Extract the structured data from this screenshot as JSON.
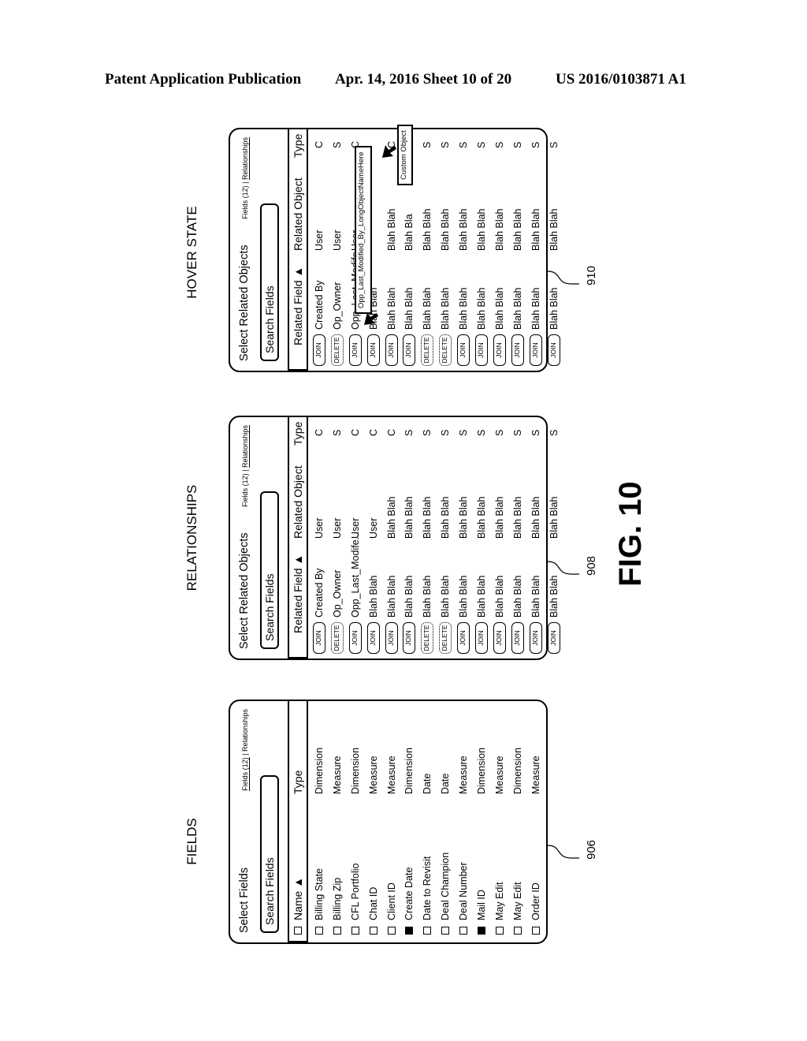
{
  "header": {
    "publication": "Patent Application Publication",
    "date_sheet": "Apr. 14, 2016  Sheet 10 of 20",
    "number": "US 2016/0103871 A1"
  },
  "figure_label": "FIG. 10",
  "panels": {
    "fields": {
      "caption": "FIELDS",
      "ref": "906",
      "title": "Select Fields",
      "tab_fields": "Fields (12)",
      "tab_sep": " | ",
      "tab_relationships": "Relationships",
      "active_tab": "fields",
      "search_placeholder": "Search Fields",
      "col_name": "Name ▲",
      "col_type": "Type",
      "rows": [
        {
          "name": "Billing State",
          "type": "Dimension",
          "checked": false
        },
        {
          "name": "Billing Zip",
          "type": "Measure",
          "checked": false
        },
        {
          "name": "CFL Portfolio",
          "type": "Dimension",
          "checked": false
        },
        {
          "name": "Chat ID",
          "type": "Measure",
          "checked": false
        },
        {
          "name": "Client ID",
          "type": "Measure",
          "checked": false
        },
        {
          "name": "Create Date",
          "type": "Dimension",
          "checked": true
        },
        {
          "name": "Date to Revisit",
          "type": "Date",
          "checked": false
        },
        {
          "name": "Deal Champion",
          "type": "Date",
          "checked": false
        },
        {
          "name": "Deal Number",
          "type": "Measure",
          "checked": false
        },
        {
          "name": "Mail ID",
          "type": "Dimension",
          "checked": true
        },
        {
          "name": "May Edit",
          "type": "Measure",
          "checked": false
        },
        {
          "name": "May Edit",
          "type": "Dimension",
          "checked": false
        },
        {
          "name": "Order ID",
          "type": "Measure",
          "checked": false
        }
      ]
    },
    "relationships": {
      "caption": "RELATIONSHIPS",
      "ref": "908",
      "title": "Select Related Objects",
      "tab_fields": "Fields (12)",
      "tab_sep": " | ",
      "tab_relationships": "Relationships",
      "active_tab": "relationships",
      "search_placeholder": "Search Fields",
      "col_field": "Related Field ▲",
      "col_object": "Related Object",
      "col_type": "Type",
      "rows": [
        {
          "action": "JOIN",
          "field": "Created By",
          "object": "User",
          "type": "C"
        },
        {
          "action": "DELETE",
          "field": "Op_Owner",
          "object": "User",
          "type": "S"
        },
        {
          "action": "JOIN",
          "field": "Opp_Last_Modife...",
          "object": "User",
          "type": "C"
        },
        {
          "action": "JOIN",
          "field": "Blah Blah",
          "object": "User",
          "type": "C"
        },
        {
          "action": "JOIN",
          "field": "Blah Blah",
          "object": "Blah Blah",
          "type": "C"
        },
        {
          "action": "JOIN",
          "field": "Blah Blah",
          "object": "Blah Blah",
          "type": "S"
        },
        {
          "action": "DELETE",
          "field": "Blah Blah",
          "object": "Blah Blah",
          "type": "S"
        },
        {
          "action": "DELETE",
          "field": "Blah Blah",
          "object": "Blah Blah",
          "type": "S"
        },
        {
          "action": "JOIN",
          "field": "Blah Blah",
          "object": "Blah Blah",
          "type": "S"
        },
        {
          "action": "JOIN",
          "field": "Blah Blah",
          "object": "Blah Blah",
          "type": "S"
        },
        {
          "action": "JOIN",
          "field": "Blah Blah",
          "object": "Blah Blah",
          "type": "S"
        },
        {
          "action": "JOIN",
          "field": "Blah Blah",
          "object": "Blah Blah",
          "type": "S"
        },
        {
          "action": "JOIN",
          "field": "Blah Blah",
          "object": "Blah Blah",
          "type": "S"
        },
        {
          "action": "JOIN",
          "field": "Blah Blah",
          "object": "Blah Blah",
          "type": "S"
        }
      ]
    },
    "hover": {
      "caption": "HOVER STATE",
      "ref": "910",
      "title": "Select Related Objects",
      "tab_fields": "Fields (12)",
      "tab_sep": " | ",
      "tab_relationships": "Relationships",
      "active_tab": "relationships",
      "search_placeholder": "Search Fields",
      "col_field": "Related Field ▲",
      "col_object": "Related Object",
      "col_type": "Type",
      "rows": [
        {
          "action": "JOIN",
          "field": "Created By",
          "object": "User",
          "type": "C"
        },
        {
          "action": "DELETE",
          "field": "Op_Owner",
          "object": "User",
          "type": "S"
        },
        {
          "action": "JOIN",
          "field": "Opp_Last_Modife...",
          "object": "User",
          "type": "C"
        },
        {
          "action": "JOIN",
          "field": "Blah Blah",
          "object": "",
          "type": ""
        },
        {
          "action": "JOIN",
          "field": "Blah Blah",
          "object": "Blah Blah",
          "type": "C"
        },
        {
          "action": "JOIN",
          "field": "Blah Blah",
          "object": "Blah Bla",
          "type": ""
        },
        {
          "action": "DELETE",
          "field": "Blah Blah",
          "object": "Blah Blah",
          "type": "S"
        },
        {
          "action": "DELETE",
          "field": "Blah Blah",
          "object": "Blah Blah",
          "type": "S"
        },
        {
          "action": "JOIN",
          "field": "Blah Blah",
          "object": "Blah Blah",
          "type": "S"
        },
        {
          "action": "JOIN",
          "field": "Blah Blah",
          "object": "Blah Blah",
          "type": "S"
        },
        {
          "action": "JOIN",
          "field": "Blah Blah",
          "object": "Blah Blah",
          "type": "S"
        },
        {
          "action": "JOIN",
          "field": "Blah Blah",
          "object": "Blah Blah",
          "type": "S"
        },
        {
          "action": "JOIN",
          "field": "Blah Blah",
          "object": "Blah Blah",
          "type": "S"
        },
        {
          "action": "JOIN",
          "field": "Blah Blah",
          "object": "Blah Blah",
          "type": "S"
        }
      ],
      "tooltip_field": "Opp_Last_Modified_By_LongObjectNameHere",
      "tooltip_type": "Custom Object"
    }
  }
}
